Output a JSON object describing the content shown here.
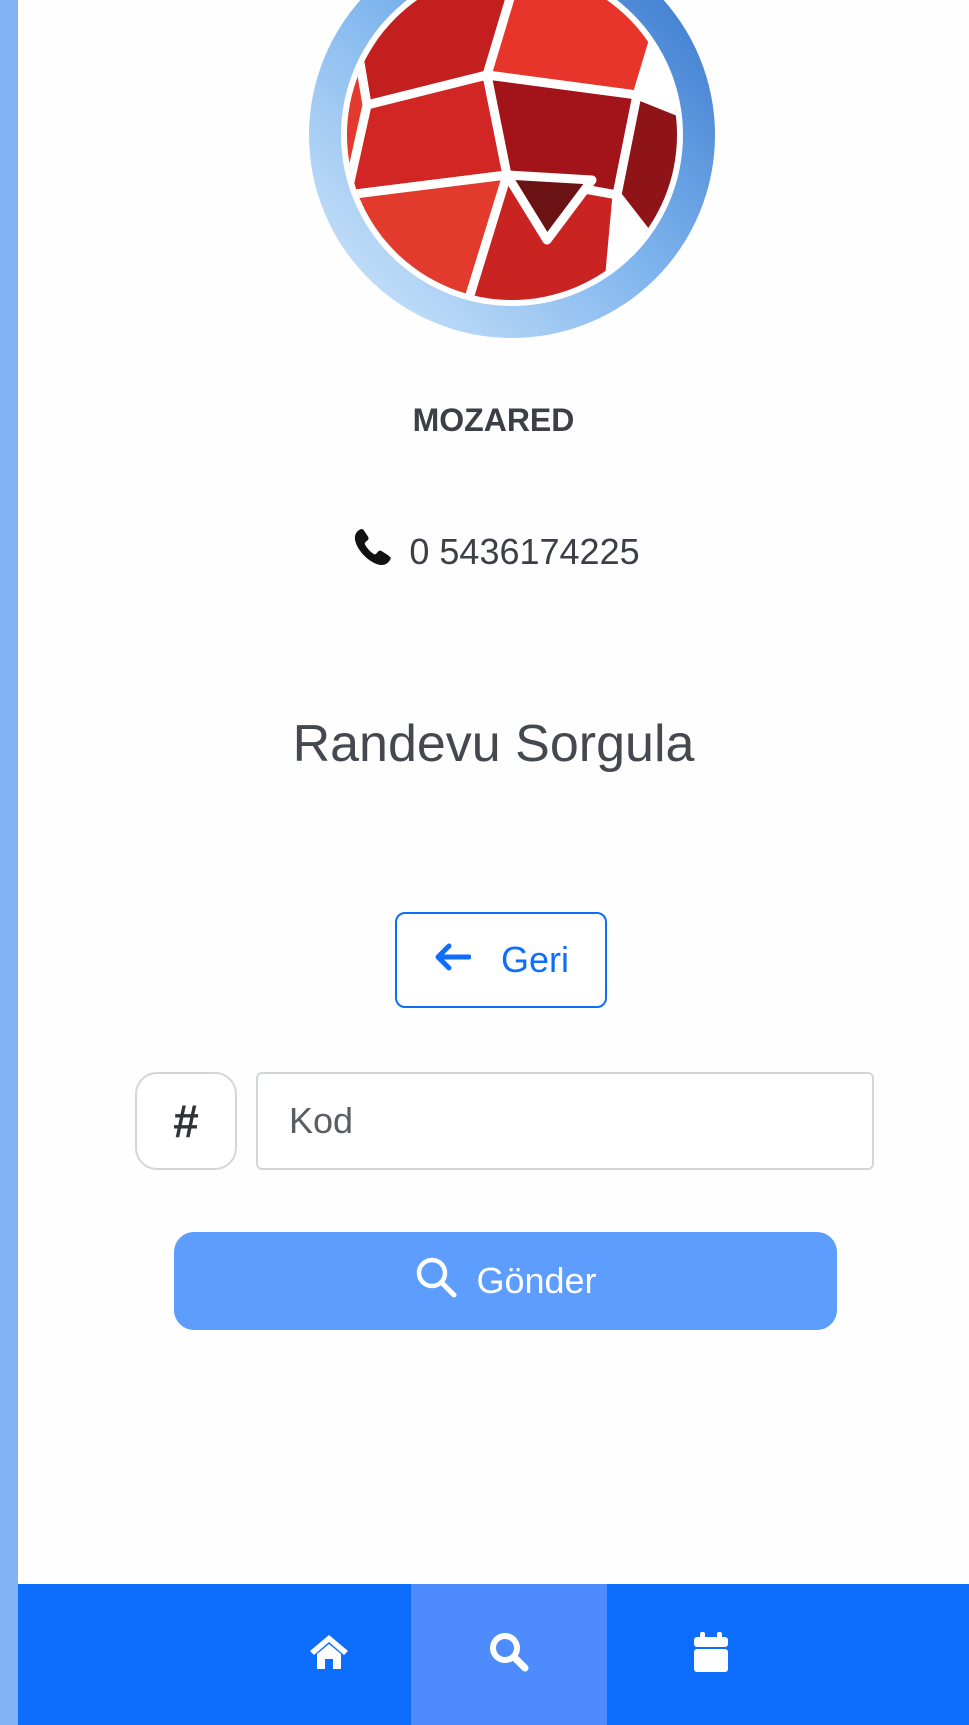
{
  "brand": {
    "name": "MOZARED",
    "phone": "0 5436174225"
  },
  "page": {
    "title": "Randevu Sorgula"
  },
  "actions": {
    "back_label": "Geri",
    "send_label": "Gönder"
  },
  "form": {
    "prefix_symbol": "#",
    "code_placeholder": "Kod",
    "code_value": ""
  },
  "bottom_nav": [
    {
      "icon": "home-icon",
      "active": false
    },
    {
      "icon": "search-icon",
      "active": true
    },
    {
      "icon": "calendar-icon",
      "active": false
    }
  ],
  "colors": {
    "primary": "#0d6efd",
    "send_button": "#5c9dfd",
    "sidebar": "#82b3f7",
    "logo_red": "#d62828"
  }
}
